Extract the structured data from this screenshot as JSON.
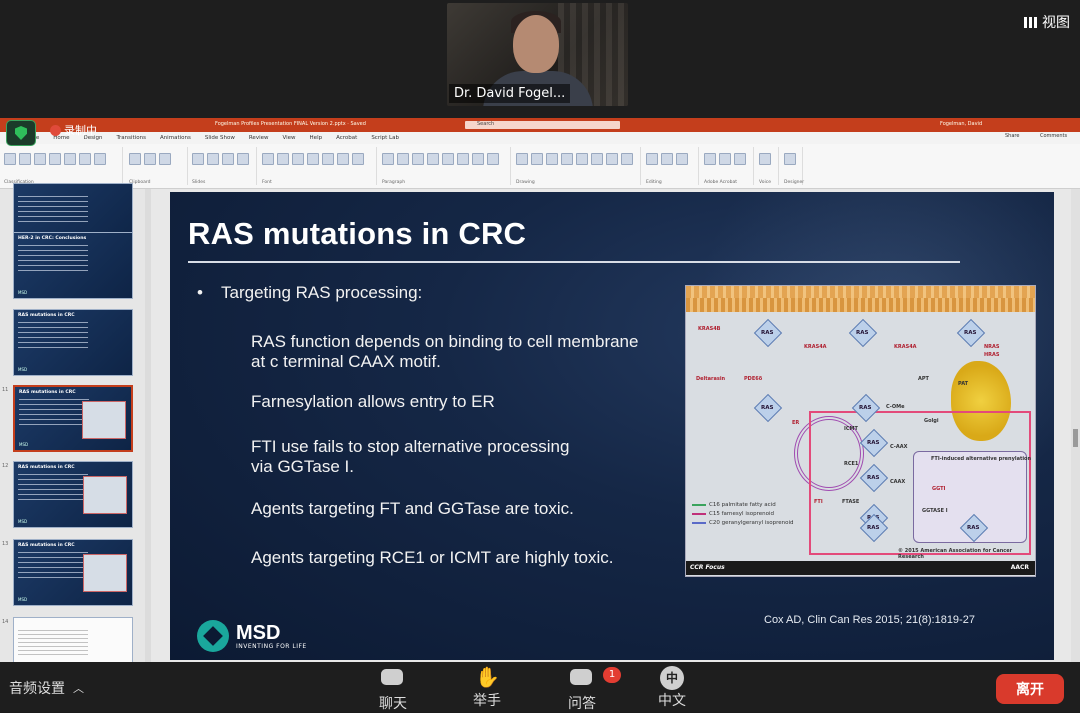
{
  "video": {
    "speaker_name": "Dr. David Fogel...",
    "view_label": "视图"
  },
  "recording": {
    "label": "录制中"
  },
  "powerpoint": {
    "window_title": "Fogelman Profiles Presentation FINAL Version 2.pptx  ·  Saved",
    "search_placeholder": "Search",
    "user_name": "Fogelman, David",
    "menu": [
      "File",
      "Home",
      "Design",
      "Transitions",
      "Animations",
      "Slide Show",
      "Review",
      "View",
      "Help",
      "Acrobat",
      "Script Lab"
    ],
    "share_label": "Share",
    "comments_label": "Comments",
    "ribbon_groups": [
      "Classification",
      "Clipboard",
      "Slides",
      "Font",
      "Paragraph",
      "Drawing",
      "Editing",
      "Adobe Acrobat",
      "Voice",
      "Designer"
    ]
  },
  "thumbnails": [
    {
      "num": "",
      "title": "",
      "foot": "",
      "selected": false
    },
    {
      "num": "",
      "title": "HER-2 in CRC: Conclusions",
      "foot": "MSD",
      "selected": false
    },
    {
      "num": "",
      "title": "RAS mutations in CRC",
      "foot": "MSD",
      "selected": false
    },
    {
      "num": "11",
      "title": "RAS mutations in CRC",
      "foot": "MSD",
      "selected": true
    },
    {
      "num": "12",
      "title": "RAS mutations in CRC",
      "foot": "MSD",
      "selected": false
    },
    {
      "num": "13",
      "title": "RAS mutations in CRC",
      "foot": "MSD",
      "selected": false
    },
    {
      "num": "14",
      "title": "",
      "foot": "",
      "selected": false
    }
  ],
  "slide": {
    "title": "RAS mutations in CRC",
    "bullet_main": "Targeting RAS processing:",
    "points": [
      [
        "RAS function depends on binding to cell membrane",
        "at c terminal CAAX motif."
      ],
      [
        "Farnesylation allows entry to ER"
      ],
      [
        "FTI use fails to stop alternative processing",
        "via GGTase I."
      ],
      [
        "Agents targeting FT and GGTase are toxic."
      ],
      [
        "Agents targeting RCE1 or ICMT are highly toxic."
      ]
    ],
    "citation": "Cox AD, Clin Can Res 2015; 21(8):1819-27",
    "logo_name": "MSD",
    "logo_tagline": "INVENTING FOR LIFE",
    "figure": {
      "ras_label": "RAS",
      "labels": {
        "kras4b": "KRAS4B",
        "kras4a": "KRAS4A",
        "kras4a2": "KRAS4A",
        "nras": "NRAS",
        "hras": "HRAS",
        "deltarasin": "Deltarasin",
        "pde6": "PDE6δ",
        "apt": "APT",
        "pat": "PAT",
        "golgi": "Golgi",
        "er": "ER",
        "icmt": "ICMT",
        "rce1": "RCE1",
        "fti": "FTI",
        "ftase": "FTASE",
        "ggti": "GGTI",
        "ggtase": "GGTASE I",
        "caax": "CAAX",
        "c_aax": "C-AAX",
        "c_ome": "C-OMe",
        "fti_box": "FTI-induced alternative prenylation",
        "copyright": "© 2015 American Association for Cancer Research"
      },
      "legend": [
        "C16 palmitate fatty acid",
        "C15 farnesyl isoprenoid",
        "C20 geranylgeranyl isoprenoid"
      ],
      "footer_left": "CCR Focus",
      "footer_right": "AACR"
    }
  },
  "toolbar": {
    "audio_settings": "音频设置",
    "chat": "聊天",
    "raise_hand": "举手",
    "qa": "问答",
    "qa_badge": "1",
    "language_icon_char": "中",
    "language": "中文",
    "leave": "离开"
  }
}
